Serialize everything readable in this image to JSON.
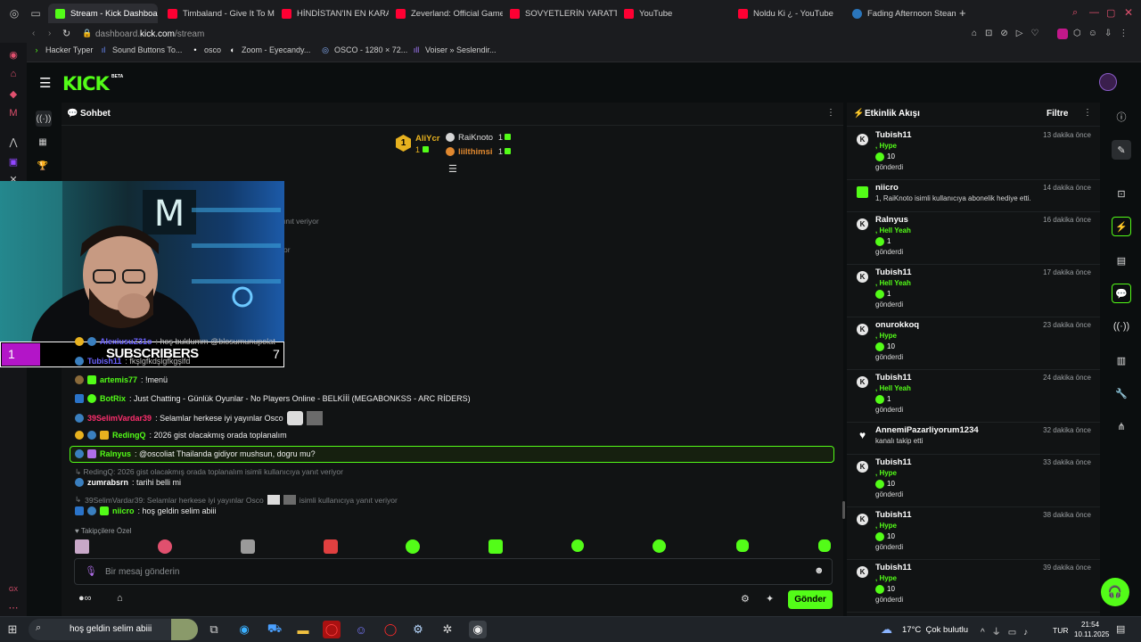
{
  "browser": {
    "tabs": [
      {
        "label": "Stream - Kick Dashboard",
        "favicon": "kick"
      },
      {
        "label": "Timbaland - Give It To Me",
        "favicon": "youtube"
      },
      {
        "label": "HİNDİSTAN'IN EN KARANL",
        "favicon": "youtube"
      },
      {
        "label": "Zeverland: Official Gamep",
        "favicon": "youtube"
      },
      {
        "label": "SOVYETLERİN YARATTIĞI",
        "favicon": "youtube"
      },
      {
        "label": "YouTube",
        "favicon": "youtube"
      },
      {
        "label": "Noldu Ki ¿ - YouTube",
        "favicon": "youtube"
      },
      {
        "label": "Fading Afternoon Steam C",
        "favicon": "steam"
      }
    ],
    "new_tab_label": "+",
    "url_prefix": "dashboard.",
    "url_domain": "kick.com",
    "url_path": "/stream",
    "bookmarks": [
      "Hacker Typer",
      "Sound Buttons To...",
      "osco",
      "Zoom - Eyecandy...",
      "OSCO - 1280 × 72...",
      "Voiser » Seslendir..."
    ]
  },
  "kick": {
    "logo": "KICK",
    "beta": "BETA"
  },
  "chat": {
    "title": "Sohbet",
    "leaders": [
      {
        "name": "AliYcr",
        "count": "1",
        "rank": "1"
      },
      {
        "name": "RaiKnoto",
        "count": "1"
      },
      {
        "name": "liilthimsi",
        "count": "1"
      }
    ],
    "hidden_fragments": [
      "ınıt veriyor",
      "or"
    ],
    "overlay_lines": [
      {
        "user": "AlexiusuZ31o",
        "text": ": hoş buldumm @blosumunupolat",
        "color": "#6c63ff"
      },
      {
        "user": "Tubish11",
        "text": ": fkşlgfkdşlgfkgşlfd",
        "color": "#6c63ff"
      }
    ],
    "messages": [
      {
        "user": "artemis77",
        "text": ": !menü",
        "color": "#53fc18"
      },
      {
        "user": "BotRix",
        "text": ": Just Chatting - Günlük Oyunlar - No Players Online - BELKİİİ (MEGABONKSS - ARC RİDERS)",
        "color": "#53fc18"
      },
      {
        "user": "39SelimVardar39",
        "text": ": Selamlar herkese iyi yayınlar Osco",
        "color": "#ff2e6e"
      },
      {
        "user": "RedingQ",
        "text": ": 2026 gist olacakmış orada toplanalım",
        "color": "#53fc18"
      },
      {
        "user": "Ralnyus",
        "text": ": @oscoliat Thailanda gidiyor mushsun, dogru mu?",
        "color": "#53fc18"
      },
      {
        "user": "zumrabsrn",
        "text": ": tarihi belli mi",
        "color": "#ffffff"
      },
      {
        "user": "niicro",
        "text": ": hoş geldin selim abiii",
        "color": "#53fc18"
      }
    ],
    "reply_1": "RedingQ: 2026 gist olacakmış orada toplanalım isimli kullanıcıya yanıt veriyor",
    "reply_2_a": "39SelimVardar39: Selamlar herkese iyi yayınlar Osco",
    "reply_2_b": "isimli kullanıcıya yanıt veriyor",
    "followers_only": "Takipçilere Özel",
    "input_placeholder": "Bir mesaj gönderin",
    "send_label": "Gönder"
  },
  "overlay": {
    "subs_left": "1",
    "subs_label": "SUBSCRIBERS",
    "subs_right": "7"
  },
  "feed": {
    "title": "Etkinlik Akışı",
    "filter_label": "Filtre",
    "items": [
      {
        "user": "Tubish11",
        "time": "13 dakika önce",
        "line1": ", Hype",
        "amount": "10",
        "line3": "gönderdi",
        "icon": "kick"
      },
      {
        "user": "niicro",
        "time": "14 dakika önce",
        "line1": "1, RaiKnoto isimli kullanıcıya abonelik hediye etti.",
        "icon": "gift"
      },
      {
        "user": "Ralnyus",
        "time": "16 dakika önce",
        "line1": ", Hell Yeah",
        "amount": "1",
        "line3": "gönderdi",
        "icon": "kick"
      },
      {
        "user": "Tubish11",
        "time": "17 dakika önce",
        "line1": ", Hell Yeah",
        "amount": "1",
        "line3": "gönderdi",
        "icon": "kick"
      },
      {
        "user": "onurokkoq",
        "time": "23 dakika önce",
        "line1": ", Hype",
        "amount": "10",
        "line3": "gönderdi",
        "icon": "kick"
      },
      {
        "user": "Tubish11",
        "time": "24 dakika önce",
        "line1": ", Hell Yeah",
        "amount": "1",
        "line3": "gönderdi",
        "icon": "kick"
      },
      {
        "user": "AnnemiPazarliyorum1234",
        "time": "32 dakika önce",
        "line1": "kanalı takip etti",
        "icon": "heart"
      },
      {
        "user": "Tubish11",
        "time": "33 dakika önce",
        "line1": ", Hype",
        "amount": "10",
        "line3": "gönderdi",
        "icon": "kick"
      },
      {
        "user": "Tubish11",
        "time": "38 dakika önce",
        "line1": ", Hype",
        "amount": "10",
        "line3": "gönderdi",
        "icon": "kick"
      },
      {
        "user": "Tubish11",
        "time": "39 dakika önce",
        "line1": ", Hype",
        "amount": "10",
        "line3": "gönderdi",
        "icon": "kick"
      }
    ]
  },
  "taskbar": {
    "search_text": "hoş geldin selim abiii",
    "weather": "17°C  Çok bulutlu",
    "lang": "TUR",
    "time": "21:54",
    "date": "10.11.2025"
  },
  "colors": {
    "accent": "#53fc18",
    "bg": "#0b0e0f",
    "panel": "#111314"
  }
}
